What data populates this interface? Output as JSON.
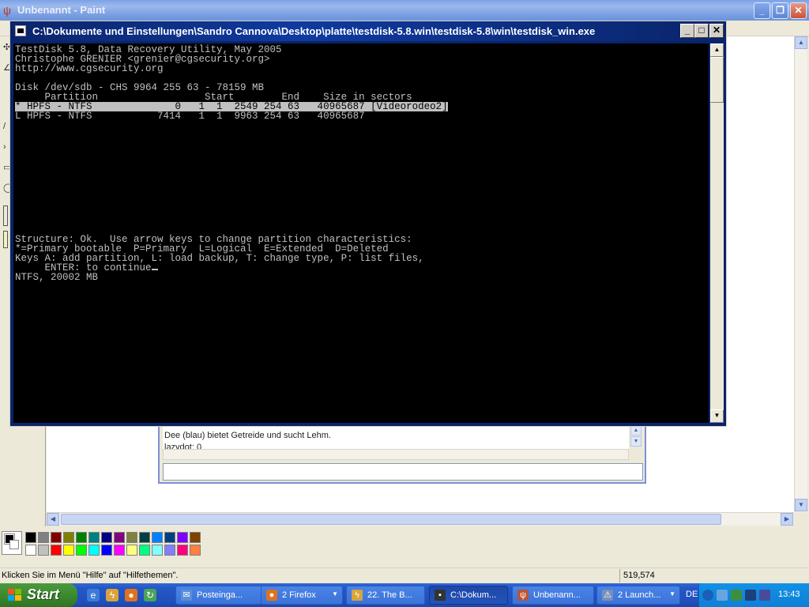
{
  "paint": {
    "title": "Unbenannt - Paint",
    "status_text": "Klicken Sie im Menü \"Hilfe\" auf \"Hilfethemen\".",
    "status_coords": "519,574"
  },
  "chat": {
    "line1": "Dee (blau) bietet Getreide und sucht Lehm.",
    "line2": "lazydot: 0"
  },
  "console": {
    "title": "C:\\Dokumente und Einstellungen\\Sandro Cannova\\Desktop\\platte\\testdisk-5.8.win\\testdisk-5.8\\win\\testdisk_win.exe",
    "lines": [
      "TestDisk 5.8, Data Recovery Utility, May 2005",
      "Christophe GRENIER <grenier@cgsecurity.org>",
      "http://www.cgsecurity.org",
      "",
      "Disk /dev/sdb - CHS 9964 255 63 - 78159 MB",
      "     Partition                  Start        End    Size in sectors",
      "* HPFS - NTFS              0   1  1  2549 254 63   40965687 [Videorodeo2]",
      "L HPFS - NTFS           7414   1  1  9963 254 63   40965687"
    ],
    "help_lines": [
      "Structure: Ok.  Use arrow keys to change partition characteristics:",
      "*=Primary bootable  P=Primary  L=Logical  E=Extended  D=Deleted",
      "Keys A: add partition, L: load backup, T: change type, P: list files,",
      "     ENTER: to continue",
      "NTFS, 20002 MB"
    ]
  },
  "palette_colors": [
    "#000000",
    "#808080",
    "#800000",
    "#808000",
    "#008000",
    "#008080",
    "#000080",
    "#800080",
    "#808040",
    "#004040",
    "#0080ff",
    "#004080",
    "#8000ff",
    "#804000",
    "#ffffff",
    "#c0c0c0",
    "#ff0000",
    "#ffff00",
    "#00ff00",
    "#00ffff",
    "#0000ff",
    "#ff00ff",
    "#ffff80",
    "#00ff80",
    "#80ffff",
    "#8080ff",
    "#ff0080",
    "#ff8040"
  ],
  "taskbar": {
    "start_label": "Start",
    "tasks": [
      {
        "label": "Posteinga...",
        "icon": "mail-icon"
      },
      {
        "label": "2 Firefox",
        "icon": "firefox-icon"
      },
      {
        "label": "22. The B...",
        "icon": "winamp-icon"
      },
      {
        "label": "C:\\Dokum...",
        "icon": "console-icon"
      },
      {
        "label": "Unbenann...",
        "icon": "paint-icon"
      },
      {
        "label": "2 Launch...",
        "icon": "launcher-icon"
      }
    ],
    "language": "DE",
    "clock": "13:43"
  }
}
